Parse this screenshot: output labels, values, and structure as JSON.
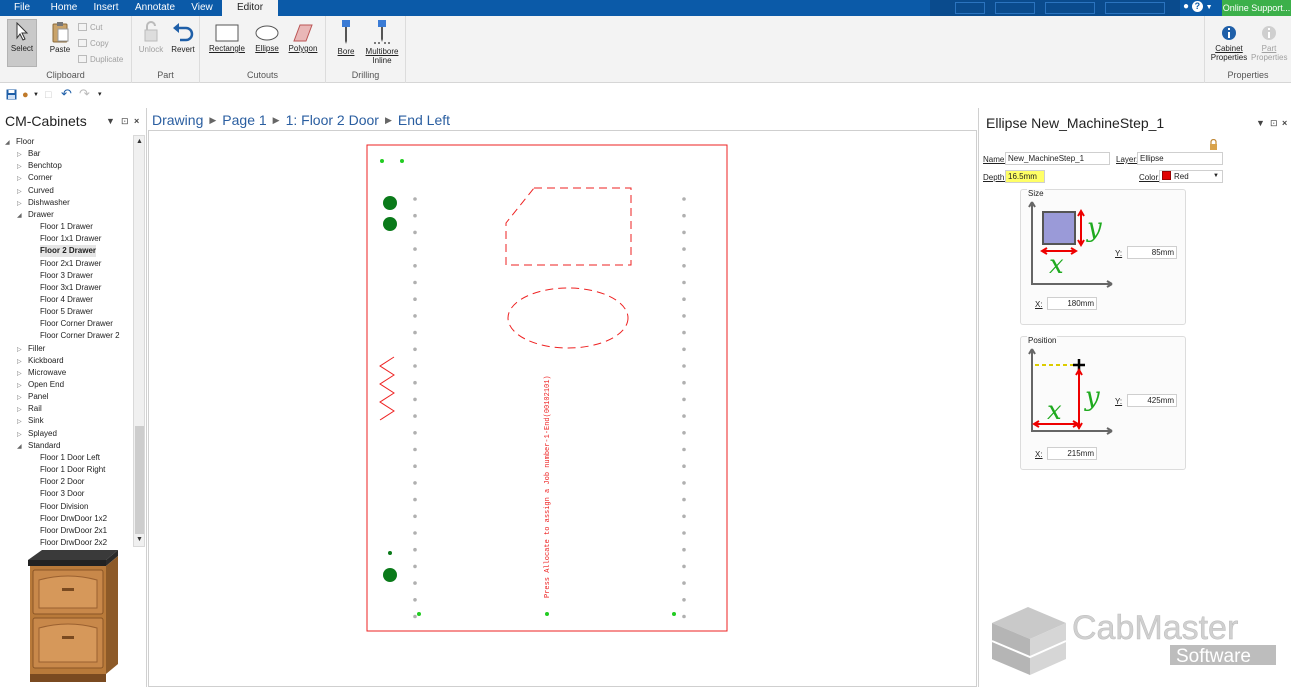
{
  "tabs": [
    "File",
    "Home",
    "Insert",
    "Annotate",
    "View",
    "Editor"
  ],
  "active_tab": "Editor",
  "online_support": "Online Support...",
  "ribbon": {
    "select": "Select",
    "paste": "Paste",
    "cut": "Cut",
    "copy": "Copy",
    "duplicate": "Duplicate",
    "clipboard_group": "Clipboard",
    "unlock": "Unlock",
    "revert": "Revert",
    "part_group": "Part",
    "rectangle": "Rectangle",
    "ellipse": "Ellipse",
    "polygon": "Polygon",
    "cutouts_group": "Cutouts",
    "bore": "Bore",
    "multibore_line1": "Multibore",
    "multibore_line2": "Inline",
    "drilling_group": "Drilling",
    "cabinet_properties_line1": "Cabinet",
    "cabinet_properties_line2": "Properties",
    "part_properties_line1": "Part",
    "part_properties_line2": "Properties",
    "properties_group": "Properties"
  },
  "left_panel": {
    "title": "CM-Cabinets",
    "tree": [
      {
        "label": "Floor",
        "level": 0,
        "expander": "open"
      },
      {
        "label": "Bar",
        "level": 1,
        "expander": "closed"
      },
      {
        "label": "Benchtop",
        "level": 1,
        "expander": "closed"
      },
      {
        "label": "Corner",
        "level": 1,
        "expander": "closed"
      },
      {
        "label": "Curved",
        "level": 1,
        "expander": "closed"
      },
      {
        "label": "Dishwasher",
        "level": 1,
        "expander": "closed"
      },
      {
        "label": "Drawer",
        "level": 1,
        "expander": "open"
      },
      {
        "label": "Floor 1 Drawer",
        "level": 2
      },
      {
        "label": "Floor 1x1 Drawer",
        "level": 2
      },
      {
        "label": "Floor 2 Drawer",
        "level": 2,
        "selected": true
      },
      {
        "label": "Floor 2x1 Drawer",
        "level": 2
      },
      {
        "label": "Floor 3 Drawer",
        "level": 2
      },
      {
        "label": "Floor 3x1 Drawer",
        "level": 2
      },
      {
        "label": "Floor 4 Drawer",
        "level": 2
      },
      {
        "label": "Floor 5 Drawer",
        "level": 2
      },
      {
        "label": "Floor Corner Drawer",
        "level": 2
      },
      {
        "label": "Floor Corner Drawer 2",
        "level": 2
      },
      {
        "label": "Filler",
        "level": 1,
        "expander": "closed"
      },
      {
        "label": "Kickboard",
        "level": 1,
        "expander": "closed"
      },
      {
        "label": "Microwave",
        "level": 1,
        "expander": "closed"
      },
      {
        "label": "Open End",
        "level": 1,
        "expander": "closed"
      },
      {
        "label": "Panel",
        "level": 1,
        "expander": "closed"
      },
      {
        "label": "Rail",
        "level": 1,
        "expander": "closed"
      },
      {
        "label": "Sink",
        "level": 1,
        "expander": "closed"
      },
      {
        "label": "Splayed",
        "level": 1,
        "expander": "closed"
      },
      {
        "label": "Standard",
        "level": 1,
        "expander": "open"
      },
      {
        "label": "Floor 1 Door Left",
        "level": 2
      },
      {
        "label": "Floor 1 Door Right",
        "level": 2
      },
      {
        "label": "Floor 2 Door",
        "level": 2
      },
      {
        "label": "Floor 3 Door",
        "level": 2
      },
      {
        "label": "Floor Division",
        "level": 2
      },
      {
        "label": "Floor DrwDoor 1x2",
        "level": 2
      },
      {
        "label": "Floor DrwDoor 2x1",
        "level": 2
      },
      {
        "label": "Floor DrwDoor 2x2",
        "level": 2
      }
    ]
  },
  "breadcrumb": [
    "Drawing",
    "Page 1",
    "1: Floor 2 Door",
    "End Left"
  ],
  "canvas": {
    "vertical_text": "Press Allocate to assign a Job number-1-End(00102101)"
  },
  "properties": {
    "title": "Ellipse New_MachineStep_1",
    "name_label": "Name:",
    "name_value": "New_MachineStep_1",
    "layer_label": "Layer:",
    "layer_value": "Ellipse",
    "depth_label": "Depth:",
    "depth_value": "16.5mm",
    "color_label": "Color:",
    "color_value": "Red",
    "color_swatch": "#e00000",
    "size_title": "Size",
    "size_y_label": "Y:",
    "size_y_value": "85mm",
    "size_x_label": "X:",
    "size_x_value": "180mm",
    "position_title": "Position",
    "pos_y_label": "Y:",
    "pos_y_value": "425mm",
    "pos_x_label": "X:",
    "pos_x_value": "215mm",
    "diagram_x": "x",
    "diagram_y": "y"
  },
  "logo": {
    "brand": "CabMaster",
    "sub": "Software"
  },
  "colors": {
    "ribbon_blue": "#0b5aa8",
    "online_green": "#3cb04a",
    "part_red": "#ee2222",
    "bore_green": "#0a7a1a"
  }
}
